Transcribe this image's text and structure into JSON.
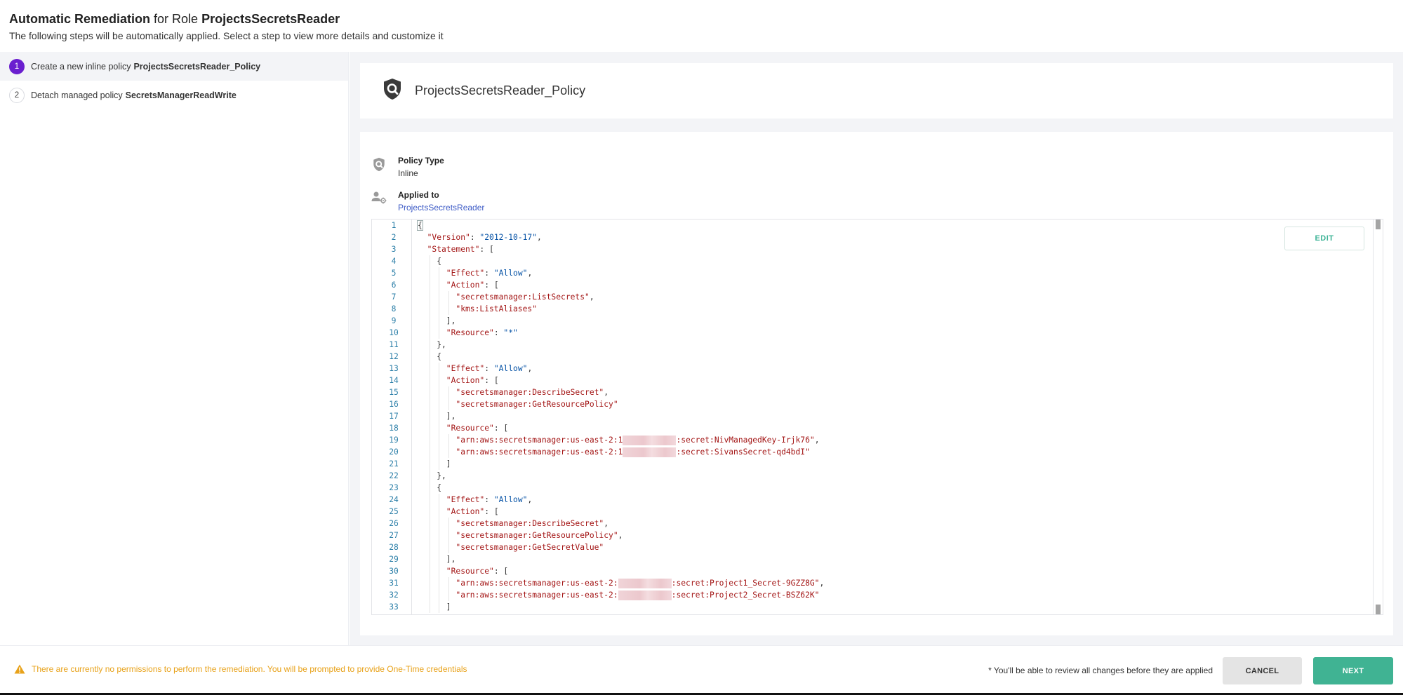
{
  "header": {
    "title_bold_1": "Automatic Remediation",
    "title_mid": " for Role ",
    "title_bold_2": "ProjectsSecretsReader",
    "subtitle": "The following steps will be automatically applied. Select a step to view more details and customize it"
  },
  "steps": [
    {
      "number": "1",
      "text": "Create a new inline policy",
      "bold": "ProjectsSecretsReader_Policy",
      "active": true
    },
    {
      "number": "2",
      "text": "Detach managed policy",
      "bold": "SecretsManagerReadWrite",
      "active": false
    }
  ],
  "policy": {
    "name": "ProjectsSecretsReader_Policy",
    "icon": "shield-search-icon",
    "type_label": "Policy Type",
    "type_value": "Inline",
    "applied_label": "Applied to",
    "applied_value": "ProjectsSecretsReader"
  },
  "editor": {
    "edit_label": "EDIT",
    "lines": [
      {
        "n": "1",
        "indent": 0,
        "tokens": [
          [
            "p",
            "{"
          ]
        ]
      },
      {
        "n": "2",
        "indent": 1,
        "tokens": [
          [
            "k",
            "\"Version\""
          ],
          [
            "p",
            ": "
          ],
          [
            "v",
            "\"2012-10-17\""
          ],
          [
            "p",
            ","
          ]
        ]
      },
      {
        "n": "3",
        "indent": 1,
        "tokens": [
          [
            "k",
            "\"Statement\""
          ],
          [
            "p",
            ": ["
          ]
        ]
      },
      {
        "n": "4",
        "indent": 2,
        "tokens": [
          [
            "p",
            "{"
          ]
        ]
      },
      {
        "n": "5",
        "indent": 3,
        "tokens": [
          [
            "k",
            "\"Effect\""
          ],
          [
            "p",
            ": "
          ],
          [
            "v",
            "\"Allow\""
          ],
          [
            "p",
            ","
          ]
        ]
      },
      {
        "n": "6",
        "indent": 3,
        "tokens": [
          [
            "k",
            "\"Action\""
          ],
          [
            "p",
            ": ["
          ]
        ]
      },
      {
        "n": "7",
        "indent": 4,
        "tokens": [
          [
            "s",
            "\"secretsmanager:ListSecrets\""
          ],
          [
            "p",
            ","
          ]
        ]
      },
      {
        "n": "8",
        "indent": 4,
        "tokens": [
          [
            "s",
            "\"kms:ListAliases\""
          ]
        ]
      },
      {
        "n": "9",
        "indent": 3,
        "tokens": [
          [
            "p",
            "],"
          ]
        ]
      },
      {
        "n": "10",
        "indent": 3,
        "tokens": [
          [
            "k",
            "\"Resource\""
          ],
          [
            "p",
            ": "
          ],
          [
            "v",
            "\"*\""
          ]
        ]
      },
      {
        "n": "11",
        "indent": 2,
        "tokens": [
          [
            "p",
            "},"
          ]
        ]
      },
      {
        "n": "12",
        "indent": 2,
        "tokens": [
          [
            "p",
            "{"
          ]
        ]
      },
      {
        "n": "13",
        "indent": 3,
        "tokens": [
          [
            "k",
            "\"Effect\""
          ],
          [
            "p",
            ": "
          ],
          [
            "v",
            "\"Allow\""
          ],
          [
            "p",
            ","
          ]
        ]
      },
      {
        "n": "14",
        "indent": 3,
        "tokens": [
          [
            "k",
            "\"Action\""
          ],
          [
            "p",
            ": ["
          ]
        ]
      },
      {
        "n": "15",
        "indent": 4,
        "tokens": [
          [
            "s",
            "\"secretsmanager:DescribeSecret\""
          ],
          [
            "p",
            ","
          ]
        ]
      },
      {
        "n": "16",
        "indent": 4,
        "tokens": [
          [
            "s",
            "\"secretsmanager:GetResourcePolicy\""
          ]
        ]
      },
      {
        "n": "17",
        "indent": 3,
        "tokens": [
          [
            "p",
            "],"
          ]
        ]
      },
      {
        "n": "18",
        "indent": 3,
        "tokens": [
          [
            "k",
            "\"Resource\""
          ],
          [
            "p",
            ": ["
          ]
        ]
      },
      {
        "n": "19",
        "indent": 4,
        "tokens": [
          [
            "s",
            "\"arn:aws:secretsmanager:us-east-2:1"
          ],
          [
            "r",
            ""
          ],
          [
            "s",
            ":secret:NivManagedKey-Irjk76\""
          ],
          [
            "p",
            ","
          ]
        ]
      },
      {
        "n": "20",
        "indent": 4,
        "tokens": [
          [
            "s",
            "\"arn:aws:secretsmanager:us-east-2:1"
          ],
          [
            "r",
            ""
          ],
          [
            "s",
            ":secret:SivansSecret-qd4bdI\""
          ]
        ]
      },
      {
        "n": "21",
        "indent": 3,
        "tokens": [
          [
            "p",
            "]"
          ]
        ]
      },
      {
        "n": "22",
        "indent": 2,
        "tokens": [
          [
            "p",
            "},"
          ]
        ]
      },
      {
        "n": "23",
        "indent": 2,
        "tokens": [
          [
            "p",
            "{"
          ]
        ]
      },
      {
        "n": "24",
        "indent": 3,
        "tokens": [
          [
            "k",
            "\"Effect\""
          ],
          [
            "p",
            ": "
          ],
          [
            "v",
            "\"Allow\""
          ],
          [
            "p",
            ","
          ]
        ]
      },
      {
        "n": "25",
        "indent": 3,
        "tokens": [
          [
            "k",
            "\"Action\""
          ],
          [
            "p",
            ": ["
          ]
        ]
      },
      {
        "n": "26",
        "indent": 4,
        "tokens": [
          [
            "s",
            "\"secretsmanager:DescribeSecret\""
          ],
          [
            "p",
            ","
          ]
        ]
      },
      {
        "n": "27",
        "indent": 4,
        "tokens": [
          [
            "s",
            "\"secretsmanager:GetResourcePolicy\""
          ],
          [
            "p",
            ","
          ]
        ]
      },
      {
        "n": "28",
        "indent": 4,
        "tokens": [
          [
            "s",
            "\"secretsmanager:GetSecretValue\""
          ]
        ]
      },
      {
        "n": "29",
        "indent": 3,
        "tokens": [
          [
            "p",
            "],"
          ]
        ]
      },
      {
        "n": "30",
        "indent": 3,
        "tokens": [
          [
            "k",
            "\"Resource\""
          ],
          [
            "p",
            ": ["
          ]
        ]
      },
      {
        "n": "31",
        "indent": 4,
        "tokens": [
          [
            "s",
            "\"arn:aws:secretsmanager:us-east-2:"
          ],
          [
            "r",
            ""
          ],
          [
            "s",
            ":secret:Project1_Secret-9GZZ8G\""
          ],
          [
            "p",
            ","
          ]
        ]
      },
      {
        "n": "32",
        "indent": 4,
        "tokens": [
          [
            "s",
            "\"arn:aws:secretsmanager:us-east-2:"
          ],
          [
            "r",
            ""
          ],
          [
            "s",
            ":secret:Project2_Secret-BSZ62K\""
          ]
        ]
      },
      {
        "n": "33",
        "indent": 3,
        "tokens": [
          [
            "p",
            "]"
          ]
        ]
      }
    ]
  },
  "footer": {
    "warning": "There are currently no permissions to perform the remediation. You will be prompted to provide One-Time credentials",
    "note": "* You'll be able to review all changes before they are applied",
    "cancel_label": "CANCEL",
    "next_label": "NEXT"
  },
  "colors": {
    "accent_purple": "#6a1fcf",
    "primary_green": "#40b393",
    "warning_orange": "#e8a21a",
    "link_blue": "#3d5bc6"
  }
}
